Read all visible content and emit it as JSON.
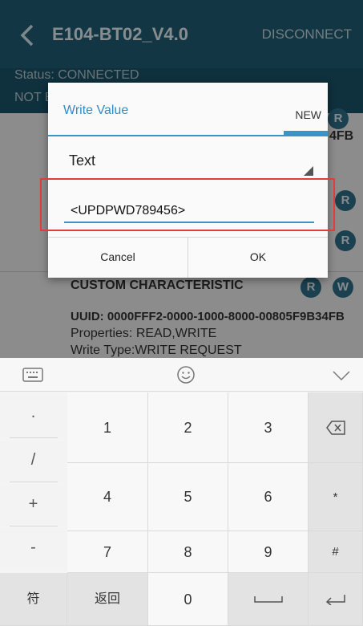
{
  "app_bar": {
    "title": "E104-BT02_V4.0",
    "disconnect": "DISCONNECT"
  },
  "status": {
    "line1": "Status: CONNECTED",
    "line2": "NOT B"
  },
  "background": {
    "uuid_fragment": "4FB",
    "char_title": "CUSTOM CHARACTERISTIC",
    "uuid": "UUID: 0000FFF2-0000-1000-8000-00805F9B34FB",
    "properties": "Properties: READ,WRITE",
    "write_type": "Write Type:WRITE REQUEST",
    "badge_r": "R",
    "badge_w": "W"
  },
  "dialog": {
    "title": "Write Value",
    "tab_new": "NEW",
    "type_value": "Text",
    "input_value": "<UPDPWD789456>",
    "cancel": "Cancel",
    "ok": "OK"
  },
  "keyboard": {
    "symbols": [
      ".",
      "/",
      "+",
      "-"
    ],
    "digits": [
      "1",
      "2",
      "3",
      "4",
      "5",
      "6",
      "7",
      "8",
      "9"
    ],
    "right": [
      "*",
      "#"
    ],
    "bottom": {
      "fu": "符",
      "back": "返回",
      "zero": "0"
    },
    "icons": [
      "keyboard-switch-icon",
      "emoji-icon",
      "collapse-icon",
      "backspace-icon",
      "space-icon",
      "enter-icon"
    ]
  },
  "colors": {
    "app_bar": "#1f5d74",
    "accent": "#3a93c9",
    "highlight": "#e23b3b"
  }
}
